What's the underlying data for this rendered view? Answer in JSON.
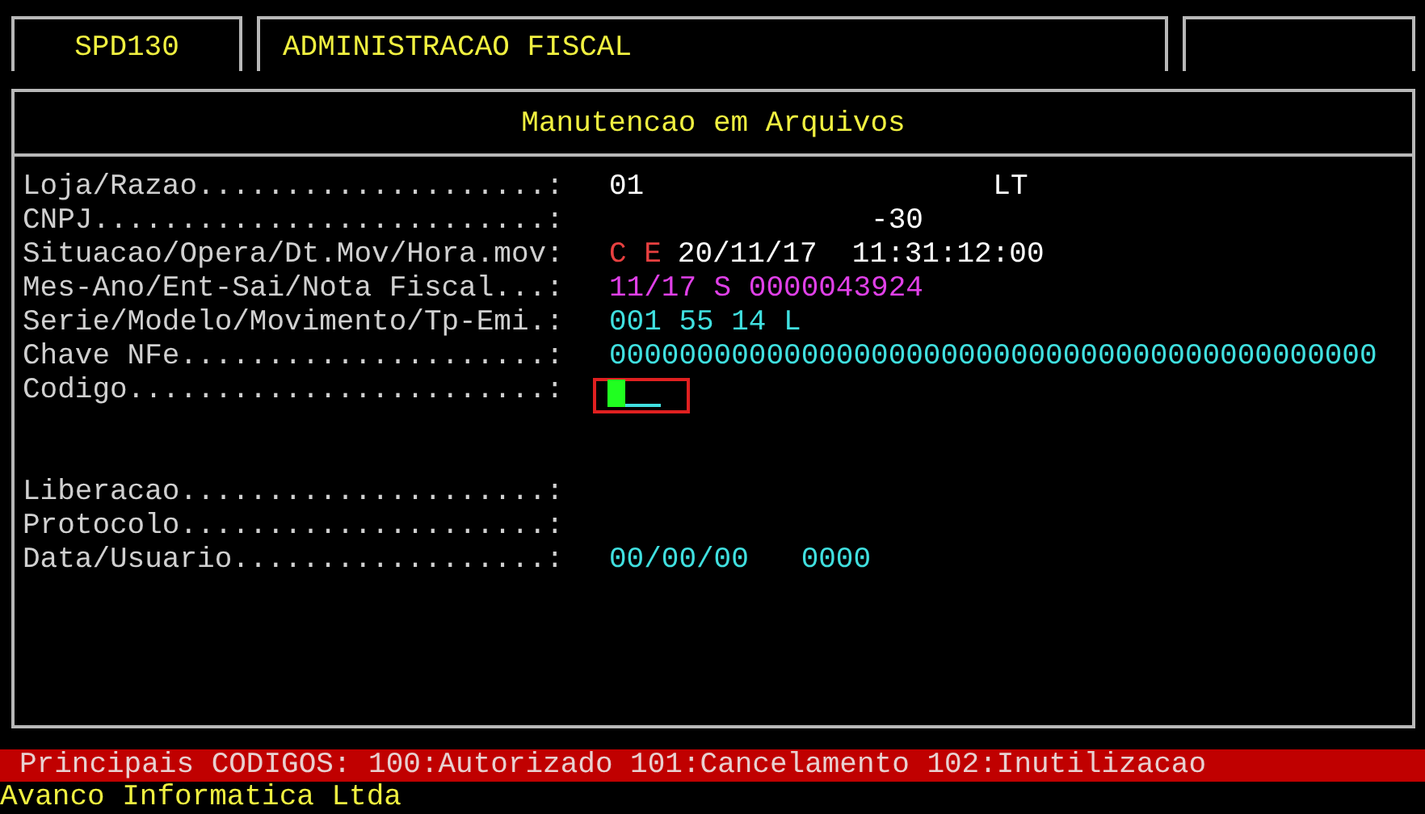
{
  "header": {
    "program": "SPD130",
    "module": "ADMINISTRACAO FISCAL"
  },
  "panel": {
    "title": "Manutencao em Arquivos",
    "field_groups": [
      [
        {
          "label": "Loja/Razao....................:",
          "kind": "text",
          "segments": [
            {
              "text": "01                    LT",
              "color": "#ffffff"
            }
          ]
        },
        {
          "label": "CNPJ..........................:",
          "kind": "text",
          "segments": [
            {
              "text": "               -30",
              "color": "#ffffff"
            }
          ]
        },
        {
          "label": "Situacao/Opera/Dt.Mov/Hora.mov:",
          "kind": "text",
          "segments": [
            {
              "text": "C E",
              "color": "#e84040"
            },
            {
              "text": "20/11/17  11:31:12:00",
              "color": "#ffffff"
            }
          ]
        },
        {
          "label": "Mes-Ano/Ent-Sai/Nota Fiscal...:",
          "kind": "text",
          "segments": [
            {
              "text": "11/17 S 0000043924",
              "color": "#e040e8"
            }
          ]
        },
        {
          "label": "Serie/Modelo/Movimento/Tp-Emi.:",
          "kind": "text",
          "segments": [
            {
              "text": "001 55 14 L",
              "color": "#40e0e0"
            }
          ]
        },
        {
          "label": "Chave NFe.....................:",
          "kind": "text",
          "segments": [
            {
              "text": "00000000000000000000000000000000000000000000",
              "color": "#40e0e0"
            }
          ]
        },
        {
          "label": "Codigo........................:",
          "kind": "input"
        }
      ],
      [
        {
          "label": "Liberacao.....................:",
          "kind": "text"
        },
        {
          "label": "Protocolo.....................:",
          "kind": "text"
        },
        {
          "label": "Data/Usuario..................:",
          "kind": "text",
          "segments": [
            {
              "text": "00/00/00   0000",
              "color": "#40e0e0"
            }
          ]
        }
      ]
    ]
  },
  "status_bar": "Principais CODIGOS: 100:Autorizado 101:Cancelamento 102:Inutilizacao",
  "footer": "Avanco Informatica Ltda"
}
